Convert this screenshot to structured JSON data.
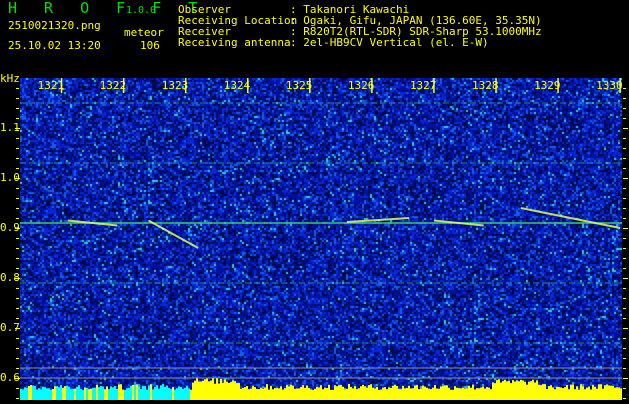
{
  "header": {
    "app_name": "H R O F F T",
    "version": "1.0.0",
    "filename": "2510021320.png",
    "datetime": "25.10.02 13:20",
    "meteor_label": "meteor",
    "meteor_count": "106",
    "info": [
      {
        "label": "Observer",
        "value": ": Takanori Kawachi"
      },
      {
        "label": "Receiving Location",
        "value": ": Ogaki, Gifu, JAPAN (136.60E, 35.35N)"
      },
      {
        "label": "Receiver",
        "value": ": R820T2(RTL-SDR) SDR-Sharp 53.1000MHz"
      },
      {
        "label": "Receiving antenna",
        "value": ": 2el-HB9CV Vertical (el. E-W)"
      }
    ]
  },
  "chart_data": {
    "type": "heatmap",
    "title": "",
    "ylabel": "kHz",
    "xlabel": "",
    "xlim": [
      1320.33,
      1330.03
    ],
    "ylim": [
      0.556,
      1.2
    ],
    "x_ticks": [
      "1321",
      "1322",
      "1323",
      "1324",
      "1325",
      "1326",
      "1327",
      "1328",
      "1329",
      "1330"
    ],
    "y_ticks": [
      "1.1",
      "1.0",
      "0.9",
      "0.8",
      "0.7",
      "0.6"
    ],
    "carrier_lines_khz": [
      1.15,
      1.03,
      0.91,
      0.79,
      0.67
    ],
    "reference_lines_khz": [
      0.62,
      0.6
    ],
    "meteor_echoes": [
      {
        "start": 1321.1,
        "end": 1321.9,
        "f0": 0.915,
        "f1": 0.905
      },
      {
        "start": 1322.4,
        "end": 1323.2,
        "f0": 0.915,
        "f1": 0.86
      },
      {
        "start": 1325.6,
        "end": 1326.6,
        "f0": 0.912,
        "f1": 0.92
      },
      {
        "start": 1327.0,
        "end": 1327.8,
        "f0": 0.915,
        "f1": 0.905
      },
      {
        "start": 1328.4,
        "end": 1330.0,
        "f0": 0.94,
        "f1": 0.9
      }
    ],
    "colors": {
      "noise": "#0020c0",
      "carrier": "#20e0a0",
      "signal_bar": "#ffff00",
      "signal_bar_low": "#00ffff"
    }
  }
}
